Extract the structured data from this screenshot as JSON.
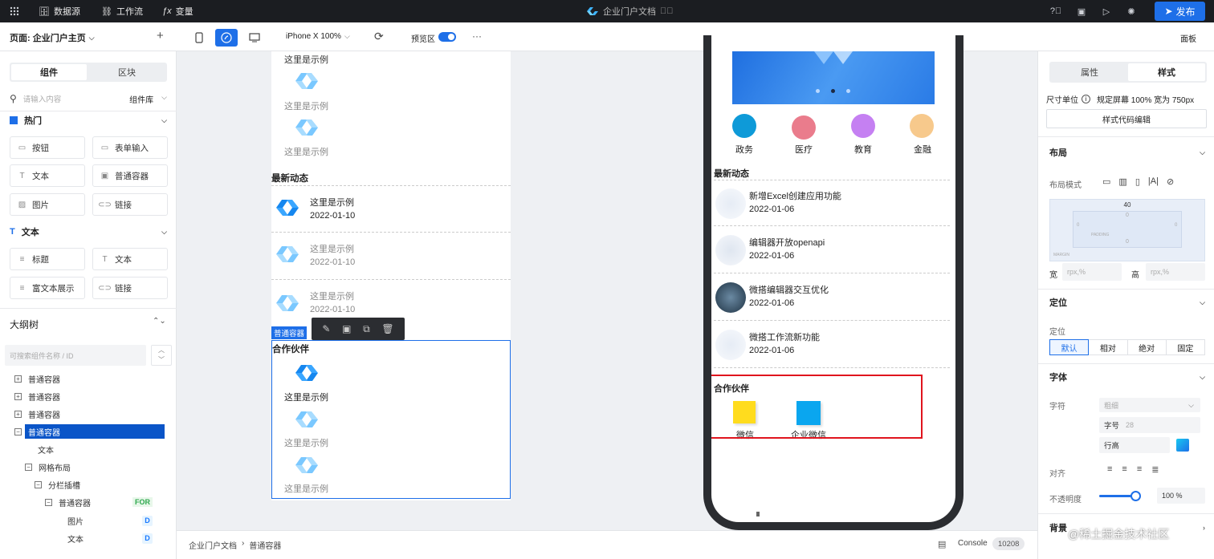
{
  "topbar": {
    "grid_icon": "grid-icon",
    "datasource": "数据源",
    "workflow": "工作流",
    "variables": "变量",
    "doc_title": "企业门户文档",
    "publish": "发布"
  },
  "toolbar": {
    "page_label": "页面: 企业门户主页",
    "add": "+",
    "device": "iPhone X 100%",
    "preview": "预览区",
    "more": "···",
    "panel": "面板"
  },
  "left": {
    "tab_components": "组件",
    "tab_blocks": "区块",
    "search_placeholder": "请输入内容",
    "library": "组件库",
    "section_hot": "热门",
    "hot_items": [
      "按钮",
      "表单输入",
      "文本",
      "普通容器",
      "图片",
      "链接"
    ],
    "section_text": "文本",
    "text_items": [
      "标题",
      "文本",
      "富文本展示",
      "链接"
    ],
    "outline_title": "大纲树",
    "outline_search": "可搜索组件名称 / ID",
    "tree": [
      {
        "label": "普通容器"
      },
      {
        "label": "普通容器"
      },
      {
        "label": "普通容器"
      },
      {
        "label": "普通容器"
      },
      {
        "label": "文本"
      },
      {
        "label": "网格布局"
      },
      {
        "label": "分栏插槽"
      },
      {
        "label": "普通容器",
        "badge": "FOR"
      },
      {
        "label": "图片",
        "badge": "D"
      },
      {
        "label": "文本",
        "badge": "D"
      }
    ]
  },
  "page": {
    "example": "这里是示例",
    "news_title": "最新动态",
    "news_date": "2022-01-10",
    "selected_tag": "普通容器",
    "partners_title": "合作伙伴"
  },
  "phone": {
    "categories": [
      {
        "label": "政务",
        "color": "#0e9ad8"
      },
      {
        "label": "医疗",
        "color": "#ea7c8c"
      },
      {
        "label": "教育",
        "color": "#c580f2"
      },
      {
        "label": "金融",
        "color": "#f7c98c"
      }
    ],
    "news_title": "最新动态",
    "news": [
      {
        "title": "新增Excel创建应用功能",
        "date": "2022-01-06"
      },
      {
        "title": "编辑器开放openapi",
        "date": "2022-01-06"
      },
      {
        "title": "微搭编辑器交互优化",
        "date": "2022-01-06"
      },
      {
        "title": "微搭工作流新功能",
        "date": "2022-01-06"
      }
    ],
    "partners_title": "合作伙伴",
    "partners": [
      {
        "label": "微信",
        "color": "#ffdc1e"
      },
      {
        "label": "企业微信",
        "color": "#0aa6ef"
      }
    ]
  },
  "right": {
    "tab_props": "属性",
    "tab_style": "样式",
    "unit_label": "尺寸单位",
    "unit_text": "规定屏幕 100% 宽为 750px",
    "code_btn": "样式代码编辑",
    "layout": "布局",
    "layout_mode": "布局模式",
    "margin_top": "40",
    "inner_top": "0",
    "inner_r1": "0",
    "inner_r2": "0",
    "padding_label": "PADDING",
    "inner_bottom": "0",
    "margin_label": "MARGIN",
    "width": "宽",
    "height": "高",
    "unit_ph": "rpx,%",
    "position": "定位",
    "position_label": "定位",
    "pos_opts": [
      "默认",
      "相对",
      "绝对",
      "固定"
    ],
    "font": "字体",
    "font_label": "字符",
    "font_weight": "粗细",
    "font_size": "字号",
    "font_size_val": "28",
    "line_height": "行高",
    "align": "对齐",
    "opacity": "不透明度",
    "opacity_val": "100 %",
    "opacity_fraction": 0.9,
    "background": "背景"
  },
  "status": {
    "crumb1": "企业门户文档",
    "crumb2": "普通容器",
    "console": "Console",
    "console_count": "10208"
  },
  "watermark": "@稀土掘金技术社区"
}
